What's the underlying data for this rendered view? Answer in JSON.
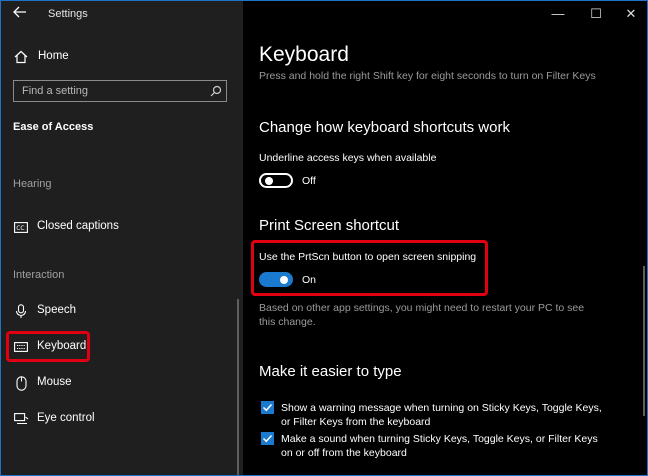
{
  "window": {
    "title": "Settings",
    "controls": {
      "minimize": "—",
      "maximize": "☐",
      "close": "✕"
    }
  },
  "sidebar": {
    "home_label": "Home",
    "search": {
      "placeholder": "Find a setting"
    },
    "category_title": "Ease of Access",
    "sections": {
      "hearing": "Hearing",
      "interaction": "Interaction"
    },
    "items": [
      {
        "label": "Closed captions",
        "icon": "closed-captions-icon"
      },
      {
        "label": "Speech",
        "icon": "microphone-icon"
      },
      {
        "label": "Keyboard",
        "icon": "keyboard-icon",
        "selected": true
      },
      {
        "label": "Mouse",
        "icon": "mouse-icon"
      },
      {
        "label": "Eye control",
        "icon": "eye-control-icon"
      }
    ]
  },
  "content": {
    "page_title": "Keyboard",
    "filter_keys_hint": "Press and hold the right Shift key for eight seconds to turn on Filter Keys",
    "shortcuts": {
      "heading": "Change how keyboard shortcuts work",
      "underline_label": "Underline access keys when available",
      "underline_state": "Off"
    },
    "print_screen": {
      "heading": "Print Screen shortcut",
      "prtscn_label": "Use the PrtScn button to open screen snipping",
      "prtscn_state": "On",
      "note_line1": "Based on other app settings, you might need to restart your PC to see",
      "note_line2": "this change."
    },
    "typing": {
      "heading": "Make it easier to type",
      "warning_line1": "Show a warning message when turning on Sticky Keys, Toggle Keys,",
      "warning_line2": "or Filter Keys from the keyboard",
      "sound_line1": "Make a sound when turning Sticky Keys, Toggle Keys, or Filter Keys",
      "sound_line2": "on or off from the keyboard"
    }
  },
  "colors": {
    "accent": "#1a7ad0",
    "highlight": "#e00012",
    "sidebar_bg": "#1f1f1f",
    "content_bg": "#000000"
  }
}
